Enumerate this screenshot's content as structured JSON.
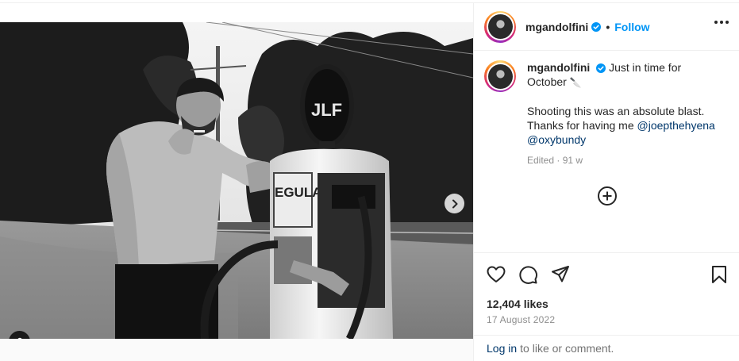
{
  "post": {
    "username": "mgandolfini",
    "follow_label": "Follow",
    "separator": "•"
  },
  "caption": {
    "username": "mgandolfini",
    "line1": "Just in time for",
    "line2": "October",
    "emoji": "🔪",
    "para2_text": "Shooting this was an absolute blast. Thanks for having me",
    "mention1": "@joepthehyena",
    "mention2": "@oxybundy",
    "edited": "Edited · 91 w"
  },
  "stats": {
    "likes": "12,404 likes",
    "date": "17 August 2022"
  },
  "footer": {
    "login": "Log in",
    "rest": "to like or comment."
  },
  "media": {
    "pump_text_top": "JLF",
    "pump_text_label": "EGULAR",
    "carousel_dots": 2,
    "active_dot": 0
  },
  "colors": {
    "accent": "#0095f6",
    "mention": "#00376b",
    "verified": "#0095f6",
    "muted": "#8e8e8e"
  },
  "icons": [
    "verified-icon",
    "more-options-icon",
    "add-comment-icon",
    "heart-icon",
    "comment-icon",
    "share-icon",
    "bookmark-icon",
    "chevron-right-icon",
    "user-tag-icon"
  ]
}
